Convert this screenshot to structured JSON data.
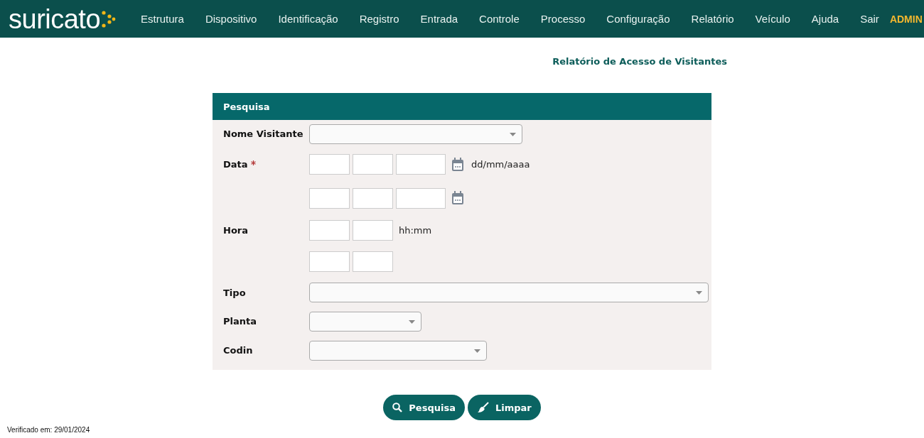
{
  "brand": {
    "name": "suricato"
  },
  "nav": {
    "items": [
      "Estrutura",
      "Dispositivo",
      "Identificação",
      "Registro",
      "Entrada",
      "Controle",
      "Processo",
      "Configuração",
      "Relatório",
      "Veículo",
      "Ajuda",
      "Sair"
    ],
    "user": "ADMIN"
  },
  "page_title": "Relatório de Acesso de Visitantes",
  "panel": {
    "title": "Pesquisa",
    "fields": [
      {
        "kind": "select",
        "label": "Nome Visitante"
      },
      {
        "kind": "date",
        "label": "Data",
        "required": true,
        "hint": "dd/mm/aaaa"
      },
      {
        "kind": "date"
      },
      {
        "kind": "time",
        "label": "Hora",
        "hint": "hh:mm"
      },
      {
        "kind": "time"
      },
      {
        "kind": "select",
        "label": "Tipo"
      },
      {
        "kind": "select",
        "label": "Planta"
      },
      {
        "kind": "select",
        "label": "Codin"
      }
    ]
  },
  "buttons": [
    {
      "kind": "search",
      "label": "Pesquisa"
    },
    {
      "kind": "clear",
      "label": "Limpar"
    }
  ],
  "footer": "Verificado em: 29/01/2024"
}
